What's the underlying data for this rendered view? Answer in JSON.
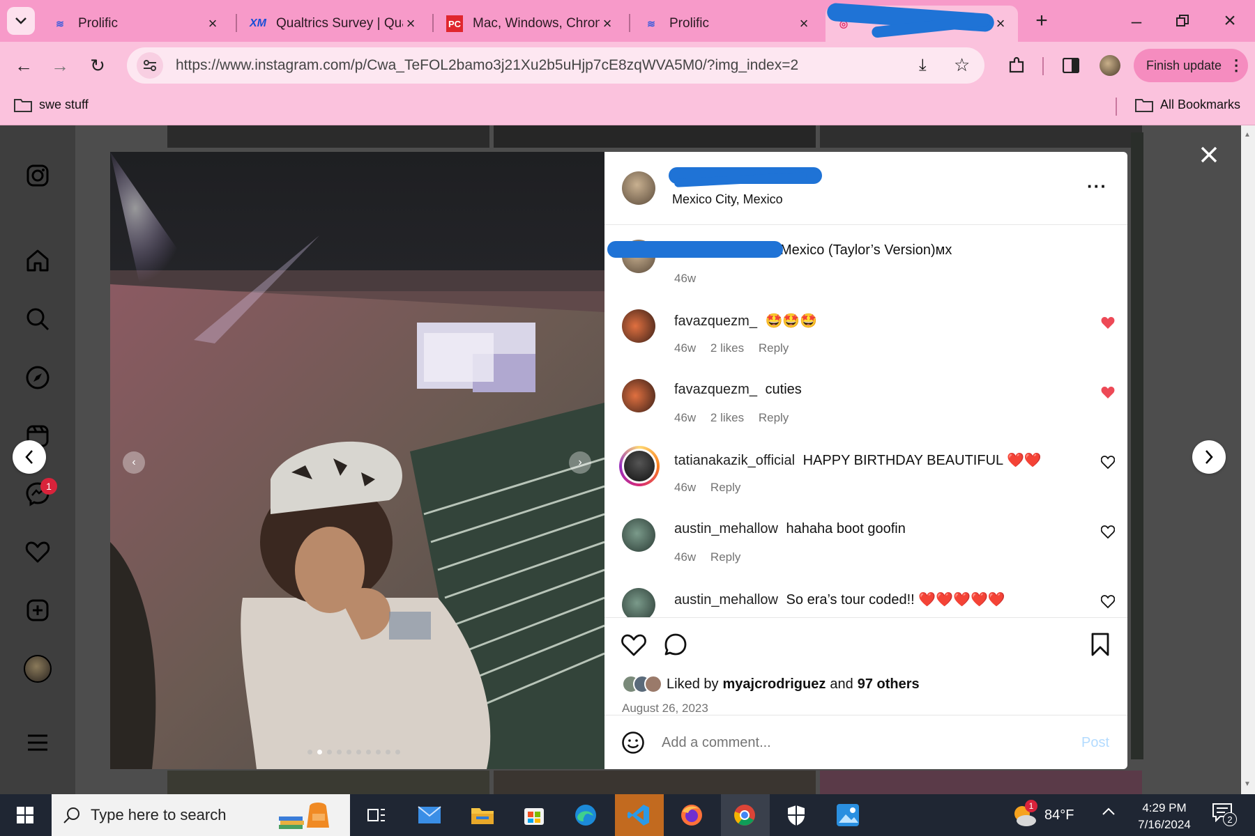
{
  "browser": {
    "tabs": [
      {
        "title": "Prolific",
        "icon": "prolific-icon"
      },
      {
        "title": "Qualtrics Survey | Qua",
        "icon": "qualtrics-icon"
      },
      {
        "title": "Mac, Windows, Chron",
        "icon": "pcmag-icon"
      },
      {
        "title": "Prolific",
        "icon": "prolific-icon"
      },
      {
        "title": "",
        "icon": "instagram-icon"
      }
    ],
    "url": "https://www.instagram.com/p/Cwa_TeFOL2bamo3j21Xu2b5uHjp7cE8zqWVA5M0/?img_index=2",
    "finish_update": "Finish update",
    "bookmarks": {
      "folder": "swe stuff",
      "all": "All Bookmarks"
    },
    "colors": {
      "tabbar": "#f79ac9",
      "toolbar": "#fbc2dd",
      "finish_button": "#f58cbf"
    }
  },
  "sidebar": {
    "icons": [
      "instagram-icon",
      "home-icon",
      "search-icon",
      "explore-icon",
      "reels-icon",
      "messenger-icon",
      "heart-icon",
      "create-icon",
      "profile-avatar",
      "menu-icon"
    ],
    "messenger_badge": "1"
  },
  "post": {
    "location": "Mexico City, Mexico",
    "caption_text": "Mexico (Taylor’s Version)ᴍx",
    "caption_time": "46w",
    "carousel_dots": 10,
    "carousel_active_index": 1,
    "comments": [
      {
        "user": "favazquezm_",
        "text": "🤩🤩🤩",
        "time": "46w",
        "likes": "2 likes",
        "reply": "Reply",
        "liked": true
      },
      {
        "user": "favazquezm_",
        "text": "cuties",
        "time": "46w",
        "likes": "2 likes",
        "reply": "Reply",
        "liked": true
      },
      {
        "user": "tatianakazik_official",
        "text": "HAPPY BIRTHDAY BEAUTIFUL ❤️❤️",
        "time": "46w",
        "reply": "Reply",
        "liked": false
      },
      {
        "user": "austin_mehallow",
        "text": "hahaha boot goofin",
        "time": "46w",
        "reply": "Reply",
        "liked": false
      },
      {
        "user": "austin_mehallow",
        "text": "So era’s tour coded!! ❤️❤️❤️❤️❤️",
        "time": "",
        "reply": "",
        "liked": false
      }
    ],
    "liked_by_prefix": "Liked by",
    "liked_by_user": "myajcrodriguez",
    "liked_by_and": "and",
    "liked_by_others": "97 others",
    "date": "August 26, 2023",
    "add_comment_placeholder": "Add a comment...",
    "post_button": "Post"
  },
  "taskbar": {
    "search_placeholder": "Type here to search",
    "weather": "84°F",
    "weather_badge": "1",
    "time": "4:29 PM",
    "date": "7/16/2024",
    "notification_count": "2",
    "apps": [
      "task-view-icon",
      "mail-icon",
      "file-explorer-icon",
      "microsoft-store-icon",
      "edge-icon",
      "vscode-icon",
      "firefox-icon",
      "chrome-icon",
      "security-icon",
      "photos-icon"
    ]
  }
}
